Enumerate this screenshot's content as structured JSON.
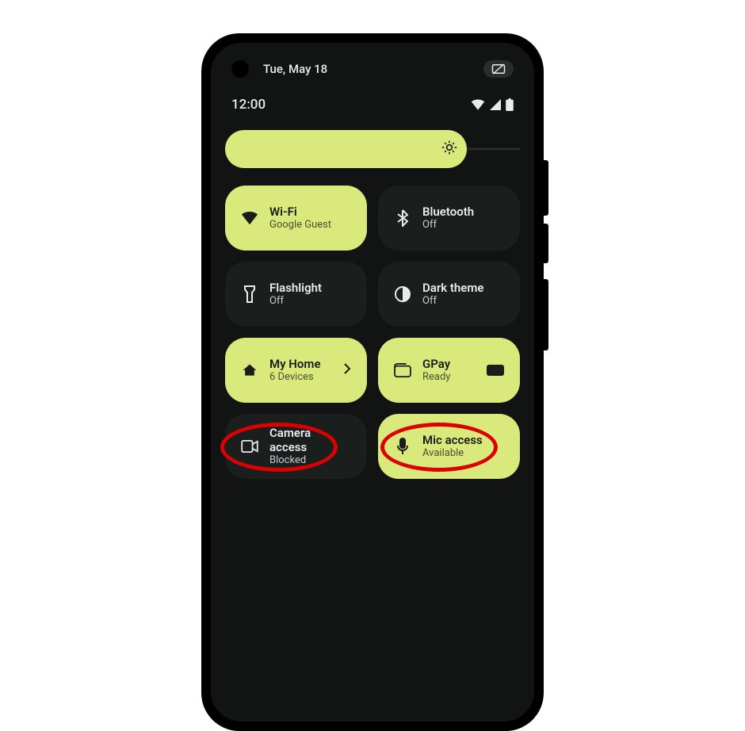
{
  "status": {
    "date": "Tue, May 18",
    "time": "12:00"
  },
  "tiles": {
    "wifi": {
      "title": "Wi-Fi",
      "sub": "Google Guest"
    },
    "bluetooth": {
      "title": "Bluetooth",
      "sub": "Off"
    },
    "flashlight": {
      "title": "Flashlight",
      "sub": "Off"
    },
    "darktheme": {
      "title": "Dark theme",
      "sub": "Off"
    },
    "home": {
      "title": "My Home",
      "sub": "6 Devices"
    },
    "gpay": {
      "title": "GPay",
      "sub": "Ready"
    },
    "camera": {
      "title": "Camera access",
      "sub": "Blocked"
    },
    "mic": {
      "title": "Mic access",
      "sub": "Available"
    }
  }
}
